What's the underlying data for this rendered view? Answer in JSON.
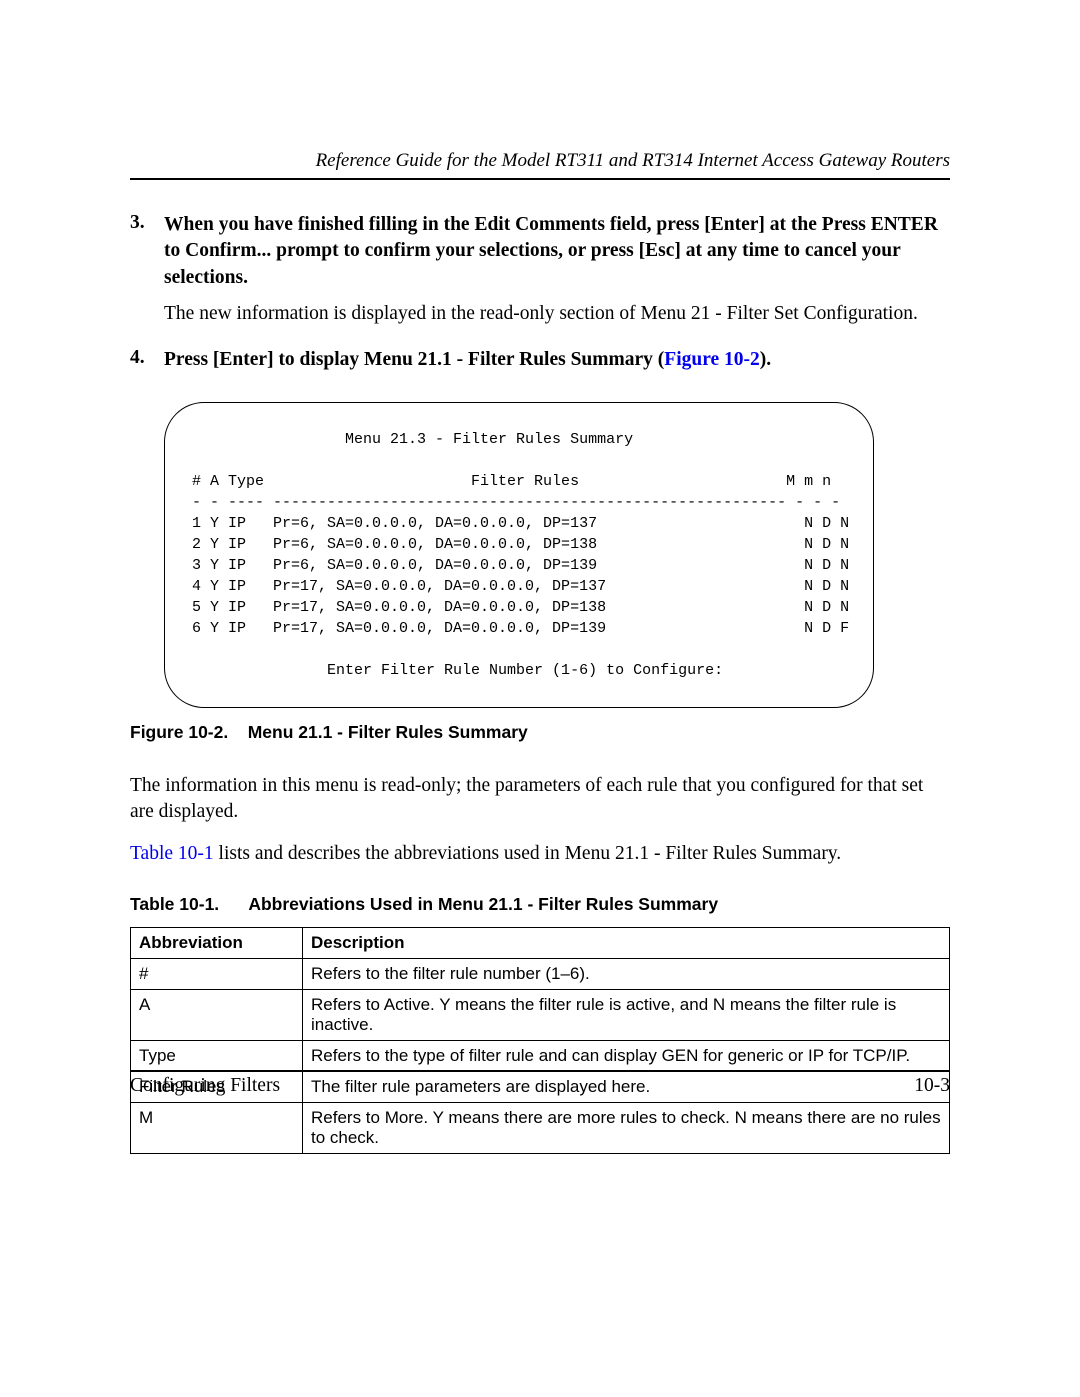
{
  "header": {
    "title": "Reference Guide for the Model RT311 and RT314 Internet Access Gateway Routers"
  },
  "steps": {
    "s3": {
      "num": "3.",
      "bold": "When you have finished filling in the Edit Comments field, press [Enter] at the Press ENTER to Confirm... prompt to confirm your selections, or press [Esc] at any time to cancel your selections.",
      "plain": "The new information is displayed in the read-only section of Menu 21 - Filter Set Configuration."
    },
    "s4": {
      "num": "4.",
      "bold_a": "Press [Enter] to display Menu 21.1 - Filter Rules Summary (",
      "xref": "Figure 10-2",
      "bold_b": ")."
    }
  },
  "figure": {
    "title_line": "                  Menu 21.3 - Filter Rules Summary",
    "head_line": " # A Type                       Filter Rules                       M m n",
    "rule_line": " - - ---- --------------------------------------------------------- - - -",
    "r1": " 1 Y IP   Pr=6, SA=0.0.0.0, DA=0.0.0.0, DP=137                       N D N",
    "r2": " 2 Y IP   Pr=6, SA=0.0.0.0, DA=0.0.0.0, DP=138                       N D N",
    "r3": " 3 Y IP   Pr=6, SA=0.0.0.0, DA=0.0.0.0, DP=139                       N D N",
    "r4": " 4 Y IP   Pr=17, SA=0.0.0.0, DA=0.0.0.0, DP=137                      N D N",
    "r5": " 5 Y IP   Pr=17, SA=0.0.0.0, DA=0.0.0.0, DP=138                      N D N",
    "r6": " 6 Y IP   Pr=17, SA=0.0.0.0, DA=0.0.0.0, DP=139                      N D F",
    "prompt_line": "                Enter Filter Rule Number (1-6) to Configure:"
  },
  "figure_caption": {
    "label": "Figure 10-2.",
    "gap": "    ",
    "text": "Menu 21.1 - Filter Rules Summary"
  },
  "paras": {
    "p1": "The information in this menu is read-only; the parameters of each rule that you configured for that set are displayed.",
    "p2a": "Table 10-1",
    "p2b": " lists and describes the abbreviations used in Menu 21.1 - Filter Rules Summary."
  },
  "table_caption": {
    "label": "Table 10-1.",
    "gap": "      ",
    "text": "Abbreviations Used in Menu 21.1 - Filter Rules Summary"
  },
  "table": {
    "h1": "Abbreviation",
    "h2": "Description",
    "rows": [
      {
        "a": "#",
        "d": "Refers to the filter rule number (1–6)."
      },
      {
        "a": "A",
        "d": "Refers to Active. Y means the filter rule is active, and N means the filter rule is inactive."
      },
      {
        "a": "Type",
        "d": "Refers to the type of filter rule and can display GEN for generic or IP for TCP/IP."
      },
      {
        "a": "Filter Rules",
        "d": "The filter rule parameters are displayed here."
      },
      {
        "a": "M",
        "d": "Refers to More. Y means there are more rules to check. N means there are no rules to check."
      }
    ]
  },
  "footer": {
    "left": "Configuring Filters",
    "right": "10-3"
  }
}
